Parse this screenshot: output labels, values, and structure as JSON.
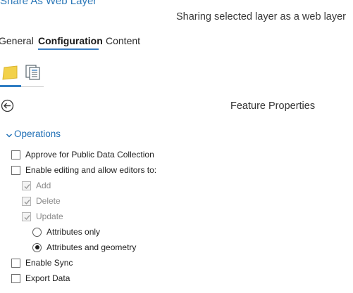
{
  "pane": {
    "title": "Share As Web Layer",
    "subtitle": "Sharing selected layer as a web layer"
  },
  "tabs": [
    {
      "label": "General",
      "active": false
    },
    {
      "label": "Configuration",
      "active": true
    },
    {
      "label": "Content",
      "active": false
    }
  ],
  "subtabs": [
    {
      "icon": "layers-folder-icon",
      "active": true
    },
    {
      "icon": "properties-list-icon",
      "active": false
    }
  ],
  "panel": {
    "back_icon": "back-arrow-icon",
    "title": "Feature Properties"
  },
  "section": {
    "label": "Operations",
    "expanded": true
  },
  "options": {
    "approve_public": {
      "label": "Approve for Public Data Collection",
      "checked": false
    },
    "enable_editing": {
      "label": "Enable editing and allow editors to:",
      "checked": false
    },
    "add": {
      "label": "Add",
      "checked": true,
      "disabled": true
    },
    "delete": {
      "label": "Delete",
      "checked": true,
      "disabled": true
    },
    "update": {
      "label": "Update",
      "checked": true,
      "disabled": true
    },
    "attributes_only": {
      "label": "Attributes only",
      "selected": false
    },
    "attributes_geometry": {
      "label": "Attributes and geometry",
      "selected": true
    },
    "enable_sync": {
      "label": "Enable Sync",
      "checked": false
    },
    "export_data": {
      "label": "Export Data",
      "checked": false
    }
  },
  "colors": {
    "accent": "#2f7dc3",
    "title_blue": "#2c78b8",
    "folder_yellow": "#f2d14a"
  }
}
